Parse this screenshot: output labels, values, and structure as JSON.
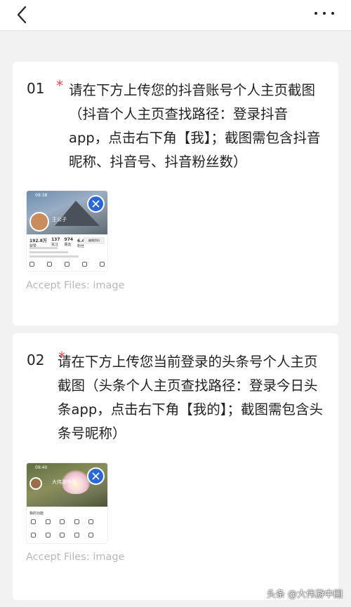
{
  "nav": {
    "back_icon": "chevron-left-icon",
    "more_icon": "ellipsis-icon"
  },
  "questions": [
    {
      "number": "01",
      "required_mark": "*",
      "text": "请在下方上传您的抖音账号个人主页截图（抖音个人主页查找路径：登录抖音app，点击右下角【我】；截图需包含抖音昵称、抖音号、抖音粉丝数）",
      "accept_files": "Accept Files: image",
      "remove_icon": "close-icon",
      "thumbnail": {
        "time": "09:38",
        "name": "王公子",
        "stats": [
          {
            "value": "192.8万",
            "label": "获赞"
          },
          {
            "value": "137",
            "label": "关注"
          },
          {
            "value": "974",
            "label": "朋友"
          },
          {
            "value": "6.4万",
            "label": "粉丝"
          }
        ],
        "edit_label": "编辑资料"
      }
    },
    {
      "number": "02",
      "required_mark": "*",
      "text": "请在下方上传您当前登录的头条号个人主页截图（头条个人主页查找路径：登录今日头条app，点击右下角【我的】；截图需包含头条号昵称）",
      "accept_files": "Accept Files: image",
      "remove_icon": "close-icon",
      "thumbnail": {
        "time": "09:40",
        "name": "大伟游中国",
        "section_title": "我的功能"
      }
    }
  ],
  "watermark": "头条 @大伟游中国",
  "colors": {
    "accent_blue": "#2a67d8",
    "required_red": "#e84a4a",
    "placeholder_gray": "#b8b8b8",
    "background": "#f2f2f2"
  }
}
